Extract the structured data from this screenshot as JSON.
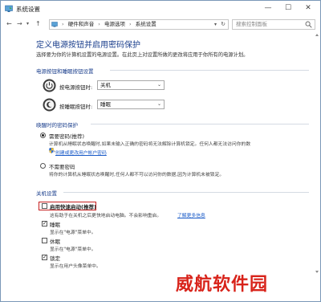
{
  "window": {
    "title": "系统设置",
    "controls": {
      "minimize": "—",
      "maximize": "☐",
      "close": "✕"
    }
  },
  "address_bar": {
    "crumbs": [
      "硬件和声音",
      "电源选项",
      "系统设置"
    ],
    "search_placeholder": "搜索控制面板"
  },
  "page": {
    "heading": "定义电源按钮并启用密码保护",
    "description": "选择要为你的计算机设置的电源设置。在此页上对设置所做的更改将应用于你所有的电源计划。"
  },
  "power_buttons": {
    "section_title": "电源按钮和睡眠按钮设置",
    "rows": [
      {
        "label": "按电源按钮时:",
        "value": "关机"
      },
      {
        "label": "按睡眠按钮时:",
        "value": "睡眠"
      }
    ]
  },
  "wake_password": {
    "section_title": "唤醒时的密码保护",
    "options": [
      {
        "label": "需要密码(推荐)",
        "selected": true,
        "desc1": "计算机从睡眠状态唤醒时,如果未输入正确的密码将无法解除计算机锁定。任何人都无法访问你的数",
        "desc2": "据。",
        "link": "创建或更改用户帐户密码"
      },
      {
        "label": "不需要密码",
        "selected": false,
        "desc1": "将你的计算机从睡眠状态唤醒时,任何人都不可以访问你的数据,因为计算机未被锁定。"
      }
    ]
  },
  "shutdown": {
    "section_title": "关机设置",
    "items": [
      {
        "label": "启用快速启动(推荐)",
        "checked": false,
        "desc": "这有助于在关机之后更快地启动电脑。不会影响重启。",
        "link": "了解更多信息"
      },
      {
        "label": "睡眠",
        "checked": true,
        "desc": "显示在\"电源\"菜单中。"
      },
      {
        "label": "休眠",
        "checked": false,
        "desc": "显示在\"电源\"菜单中。"
      },
      {
        "label": "锁定",
        "checked": true,
        "desc": "显示在用户头像菜单中。"
      }
    ]
  },
  "watermark": "威航软件园",
  "colors": {
    "heading": "#1a3e8c",
    "link": "#1a5bc8",
    "highlight": "#c62020",
    "watermark": "#d8231a"
  }
}
